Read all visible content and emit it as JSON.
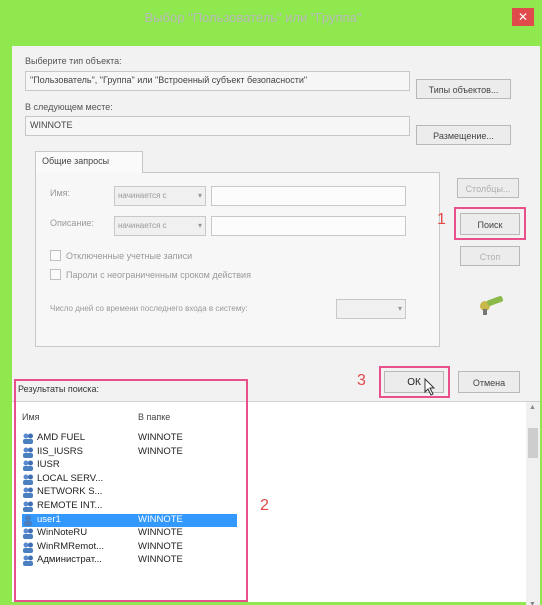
{
  "window": {
    "title": "Выбор \"Пользователь\" или \"Группа\"",
    "close_glyph": "✕"
  },
  "object_type": {
    "label": "Выберите тип объекта:",
    "value": "\"Пользователь\", \"Группа\" или \"Встроенный субъект безопасности\"",
    "button": "Типы объектов..."
  },
  "location": {
    "label": "В следующем месте:",
    "value": "WINNOTE",
    "button": "Размещение..."
  },
  "common_queries": {
    "tab": "Общие запросы",
    "name_label": "Имя:",
    "name_mode": "начинается с",
    "description_label": "Описание:",
    "description_mode": "начинается с",
    "disabled_accounts": "Отключенные учетные записи",
    "no_expire_passwords": "Пароли с неограниченным сроком действия",
    "days_since_login": "Число дней со времени последнего входа в систему:"
  },
  "side_buttons": {
    "columns": "Столбцы...",
    "search": "Поиск",
    "stop": "Стоп"
  },
  "bottom_buttons": {
    "ok": "ОК",
    "cancel": "Отмена"
  },
  "annotations": {
    "n1": "1",
    "n2": "2",
    "n3": "3"
  },
  "results": {
    "label": "Результаты поиска:",
    "col_name": "Имя",
    "col_folder": "В папке",
    "rows": [
      {
        "name": "AMD FUEL",
        "folder": "WINNOTE"
      },
      {
        "name": "IIS_IUSRS",
        "folder": "WINNOTE"
      },
      {
        "name": "IUSR",
        "folder": ""
      },
      {
        "name": "LOCAL SERV...",
        "folder": ""
      },
      {
        "name": "NETWORK S...",
        "folder": ""
      },
      {
        "name": "REMOTE INT...",
        "folder": ""
      },
      {
        "name": "user1",
        "folder": "WINNOTE"
      },
      {
        "name": "WinNoteRU",
        "folder": "WINNOTE"
      },
      {
        "name": "WinRMRemot...",
        "folder": "WINNOTE"
      },
      {
        "name": "Администрат...",
        "folder": "WINNOTE"
      }
    ]
  },
  "colors": {
    "background": "#8ee84e",
    "highlight": "#e7508a",
    "selection": "#3399ff"
  }
}
